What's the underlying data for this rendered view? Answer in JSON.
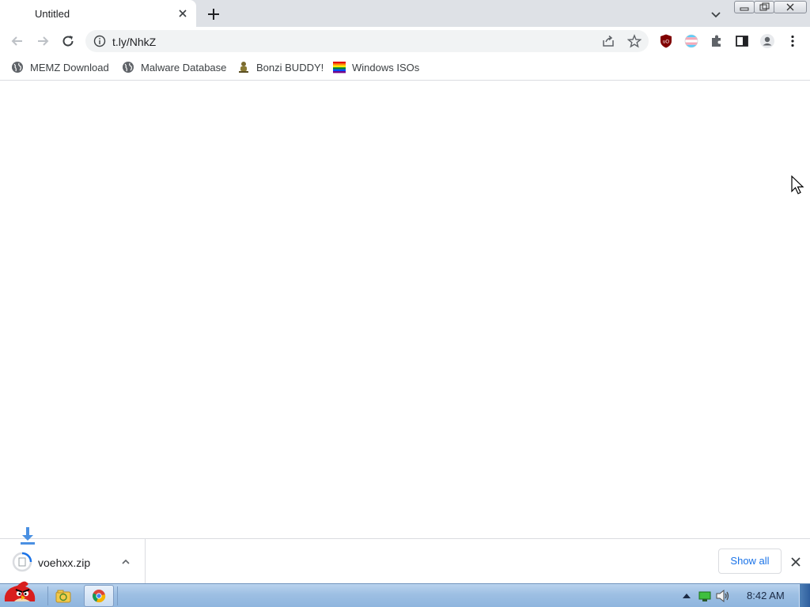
{
  "tab": {
    "title": "Untitled"
  },
  "omnibox": {
    "url": "t.ly/NhkZ"
  },
  "bookmarks": [
    {
      "label": "MEMZ Download",
      "icon": "globe-icon"
    },
    {
      "label": "Malware Database",
      "icon": "globe-icon"
    },
    {
      "label": "Bonzi BUDDY!",
      "icon": "bonzi-icon"
    },
    {
      "label": "Windows ISOs",
      "icon": "rainbow-flag-icon"
    }
  ],
  "download": {
    "filename": "voehxx.zip",
    "show_all_label": "Show all"
  },
  "taskbar": {
    "clock": "8:42 AM"
  },
  "colors": {
    "tabstrip": "#dee1e6",
    "accent": "#1a73e8",
    "taskbar": "#9dbfe3"
  }
}
